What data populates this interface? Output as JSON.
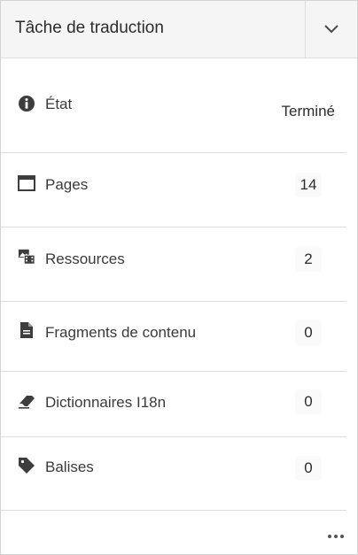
{
  "header": {
    "title": "Tâche de traduction",
    "collapse_icon": "chevron-down-icon"
  },
  "rows": [
    {
      "icon": "info-icon",
      "label": "État",
      "value": "Terminé"
    },
    {
      "icon": "pages-icon",
      "label": "Pages",
      "value": "14"
    },
    {
      "icon": "assets-icon",
      "label": "Ressources",
      "value": "2"
    },
    {
      "icon": "document-icon",
      "label": "Fragments de contenu",
      "value": "0"
    },
    {
      "icon": "eraser-icon",
      "label": "Dictionnaires I18n",
      "value": "0"
    },
    {
      "icon": "tag-icon",
      "label": "Balises",
      "value": "0"
    }
  ],
  "footer": {
    "more_icon": "more-icon"
  },
  "colors": {
    "header_bg": "#f5f5f5",
    "text": "#2c2c2c",
    "icon": "#4b4b4b",
    "divider": "#dddddd"
  }
}
